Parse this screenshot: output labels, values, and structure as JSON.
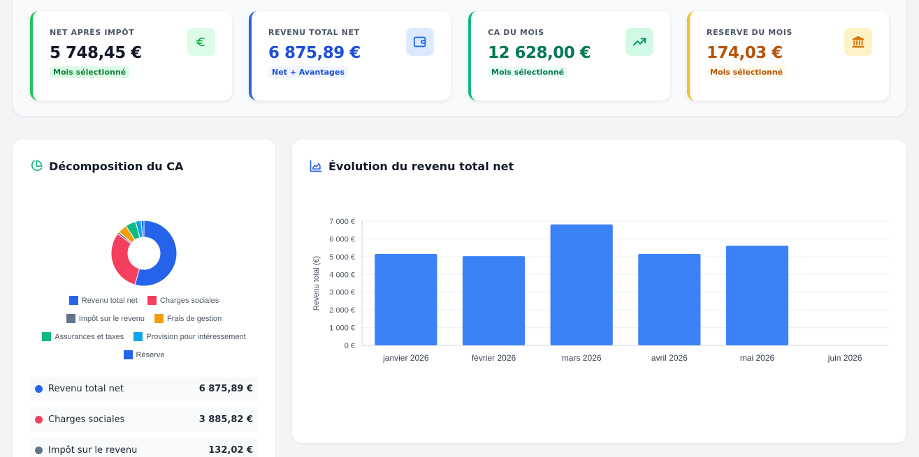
{
  "kpis": [
    {
      "label": "NET APRÈS IMPÔT",
      "value": "5 748,45 €",
      "badge": "Mois sélectionné",
      "accent": "#22c55e",
      "value_color": "#111827",
      "badge_color": "#15803d",
      "badge_bg": "#dcfce7",
      "icon_bg": "#dcfce7",
      "icon_color": "#16a34a",
      "icon": "euro-icon"
    },
    {
      "label": "REVENU TOTAL NET",
      "value": "6 875,89 €",
      "badge": "Net + Avantages",
      "accent": "#2563eb",
      "value_color": "#1d4ed8",
      "badge_color": "#1d4ed8",
      "badge_bg": "#eff6ff",
      "icon_bg": "#dbeafe",
      "icon_color": "#2563eb",
      "icon": "wallet-icon"
    },
    {
      "label": "CA DU MOIS",
      "value": "12 628,00 €",
      "badge": "Mois sélectionné",
      "accent": "#10b981",
      "value_color": "#047857",
      "badge_color": "#047857",
      "badge_bg": "#ecfdf5",
      "icon_bg": "#d1fae5",
      "icon_color": "#059669",
      "icon": "trending-up-icon"
    },
    {
      "label": "RESERVE DU MOIS",
      "value": "174,03 €",
      "badge": "Mois sélectionné",
      "accent": "#fbbf24",
      "value_color": "#b45309",
      "badge_color": "#b45309",
      "badge_bg": "#fffbeb",
      "icon_bg": "#fef3c7",
      "icon_color": "#d97706",
      "icon": "bank-icon"
    }
  ],
  "breakdown": {
    "title": "Décomposition du CA",
    "legend": [
      {
        "label": "Revenu total net",
        "color": "#2563eb"
      },
      {
        "label": "Charges sociales",
        "color": "#f43f5e"
      },
      {
        "label": "Impôt sur le revenu",
        "color": "#64748b"
      },
      {
        "label": "Frais de gestion",
        "color": "#f59e0b"
      },
      {
        "label": "Assurances et taxes",
        "color": "#10b981"
      },
      {
        "label": "Provision pour intéressement",
        "color": "#0ea5e9"
      },
      {
        "label": "Réserve",
        "color": "#2563eb"
      }
    ],
    "rows": [
      {
        "label": "Revenu total net",
        "value": "6 875,89 €",
        "color": "#2563eb"
      },
      {
        "label": "Charges sociales",
        "value": "3 885,82 €",
        "color": "#f43f5e"
      },
      {
        "label": "Impôt sur le revenu",
        "value": "132,02 €",
        "color": "#64748b"
      }
    ]
  },
  "evolution": {
    "title": "Évolution du revenu total net"
  },
  "chart_data": [
    {
      "type": "pie",
      "labels": [
        "Revenu total net",
        "Charges sociales",
        "Impôt sur le revenu",
        "Frais de gestion",
        "Assurances et taxes",
        "Provision pour intéressement",
        "Réserve"
      ],
      "values": [
        6875.89,
        3885.82,
        132.02,
        560,
        650,
        350,
        174.03
      ],
      "colors": [
        "#2563eb",
        "#f43f5e",
        "#64748b",
        "#f59e0b",
        "#10b981",
        "#0ea5e9",
        "#2563eb"
      ],
      "donut": true
    },
    {
      "type": "bar",
      "categories": [
        "janvier 2026",
        "février 2026",
        "mars 2026",
        "avril 2026",
        "mai 2026",
        "juin 2026"
      ],
      "values": [
        5150,
        5030,
        6820,
        5150,
        5620,
        0
      ],
      "ylabel": "Revenu total (€)",
      "ylim": [
        0,
        7000
      ],
      "yticks": [
        "0 €",
        "1 000 €",
        "2 000 €",
        "3 000 €",
        "4 000 €",
        "5 000 €",
        "6 000 €",
        "7 000 €"
      ],
      "color": "#3b82f6",
      "grid": true
    }
  ]
}
